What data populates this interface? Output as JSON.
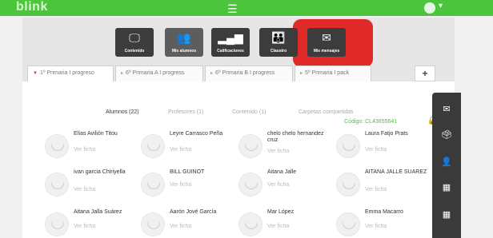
{
  "header": {
    "brand": "blink",
    "menu_icon": "menu-lines-icon",
    "user_icon": "user-avatar-icon"
  },
  "nav": {
    "buttons": [
      {
        "label": "Contenido",
        "icon": "monitor-icon",
        "glyph": "🖵"
      },
      {
        "label": "Mis alumnos",
        "icon": "students-icon",
        "glyph": "👥"
      },
      {
        "label": "Calificaciones",
        "icon": "bar-chart-icon",
        "glyph": "▂▄▆"
      },
      {
        "label": "Claustro",
        "icon": "teachers-icon",
        "glyph": "👪"
      },
      {
        "label": "Mis mensajes",
        "icon": "envelope-icon",
        "glyph": "✉"
      }
    ],
    "highlight_color": "#e01a1a"
  },
  "tabs": [
    {
      "label": "1º Primaria I progreso"
    },
    {
      "label": "6º Primaria A I progress"
    },
    {
      "label": "6º Primaria B I progress"
    },
    {
      "label": "5º Primaria I pack"
    }
  ],
  "add_tab_label": "+",
  "subtabs": [
    {
      "label": "Alumnos (22)"
    },
    {
      "label": "Profesores (1)"
    },
    {
      "label": "Contenido (1)"
    },
    {
      "label": "Carpetas compartidas"
    }
  ],
  "code": {
    "label": "Código: CL43655641"
  },
  "card_link": "Ver ficha",
  "students": [
    {
      "name": "Elías Avilión Titou"
    },
    {
      "name": "Leyre Carrasco Peña"
    },
    {
      "name": "chelo chelo hernandez cruz"
    },
    {
      "name": "Laura Fatjo Prats"
    },
    {
      "name": "ivan garcia Chiriyella"
    },
    {
      "name": "BILL GUINOT"
    },
    {
      "name": "Aitana Jalle"
    },
    {
      "name": "AITANA JALLE SUAREZ"
    },
    {
      "name": "Aitana Jalla Suárez"
    },
    {
      "name": "Aarón Jové García"
    },
    {
      "name": "Mar López"
    },
    {
      "name": "Emma Macarro"
    }
  ],
  "side_actions": [
    {
      "icon": "envelope-icon",
      "glyph": "✉"
    },
    {
      "icon": "inbox-icon",
      "glyph": "🗳"
    },
    {
      "icon": "user-edit-icon",
      "glyph": "👤"
    },
    {
      "icon": "grid-icon",
      "glyph": "▦"
    },
    {
      "icon": "grid-icon",
      "glyph": "▦"
    }
  ],
  "colors": {
    "accent": "#4bc63c",
    "dark": "#3c3c3c"
  }
}
